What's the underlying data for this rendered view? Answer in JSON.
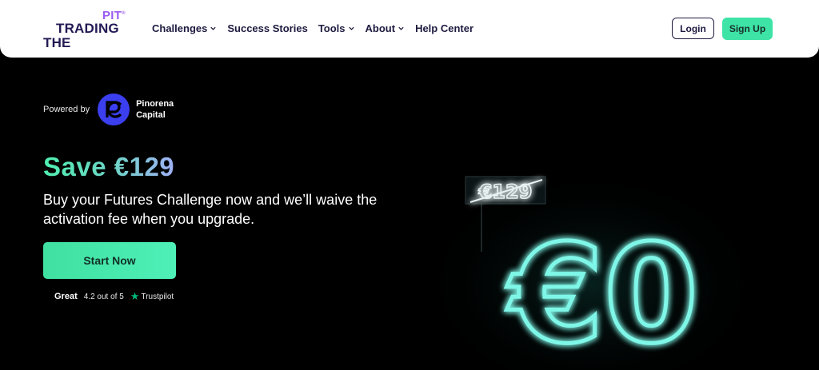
{
  "header": {
    "logo": {
      "top": "PIT",
      "mark": "®",
      "middle": "TRADING",
      "bottom": "THE"
    },
    "nav": [
      {
        "label": "Challenges",
        "dropdown": true
      },
      {
        "label": "Success Stories",
        "dropdown": false
      },
      {
        "label": "Tools",
        "dropdown": true
      },
      {
        "label": "About",
        "dropdown": true
      },
      {
        "label": "Help Center",
        "dropdown": false
      }
    ],
    "login_label": "Login",
    "signup_label": "Sign Up"
  },
  "hero": {
    "powered_by": "Powered by",
    "partner_line1": "Pinorena",
    "partner_line2": "Capital",
    "headline": "Save €129",
    "subtext": "Buy your Futures Challenge now and we’ll waive the activation fee when you upgrade.",
    "cta_label": "Start Now",
    "rating": {
      "label": "Great",
      "score_text": "4.2 out of 5",
      "provider": "Trustpilot"
    },
    "neon": {
      "old_price": "€129",
      "new_price": "€0"
    }
  },
  "colors": {
    "accent_green": "#3ee3a6",
    "brand_purple": "#9b5cf0",
    "navy": "#231a55",
    "partner_blue": "#3b3ff0",
    "neon_cyan": "#7ff7e8"
  }
}
